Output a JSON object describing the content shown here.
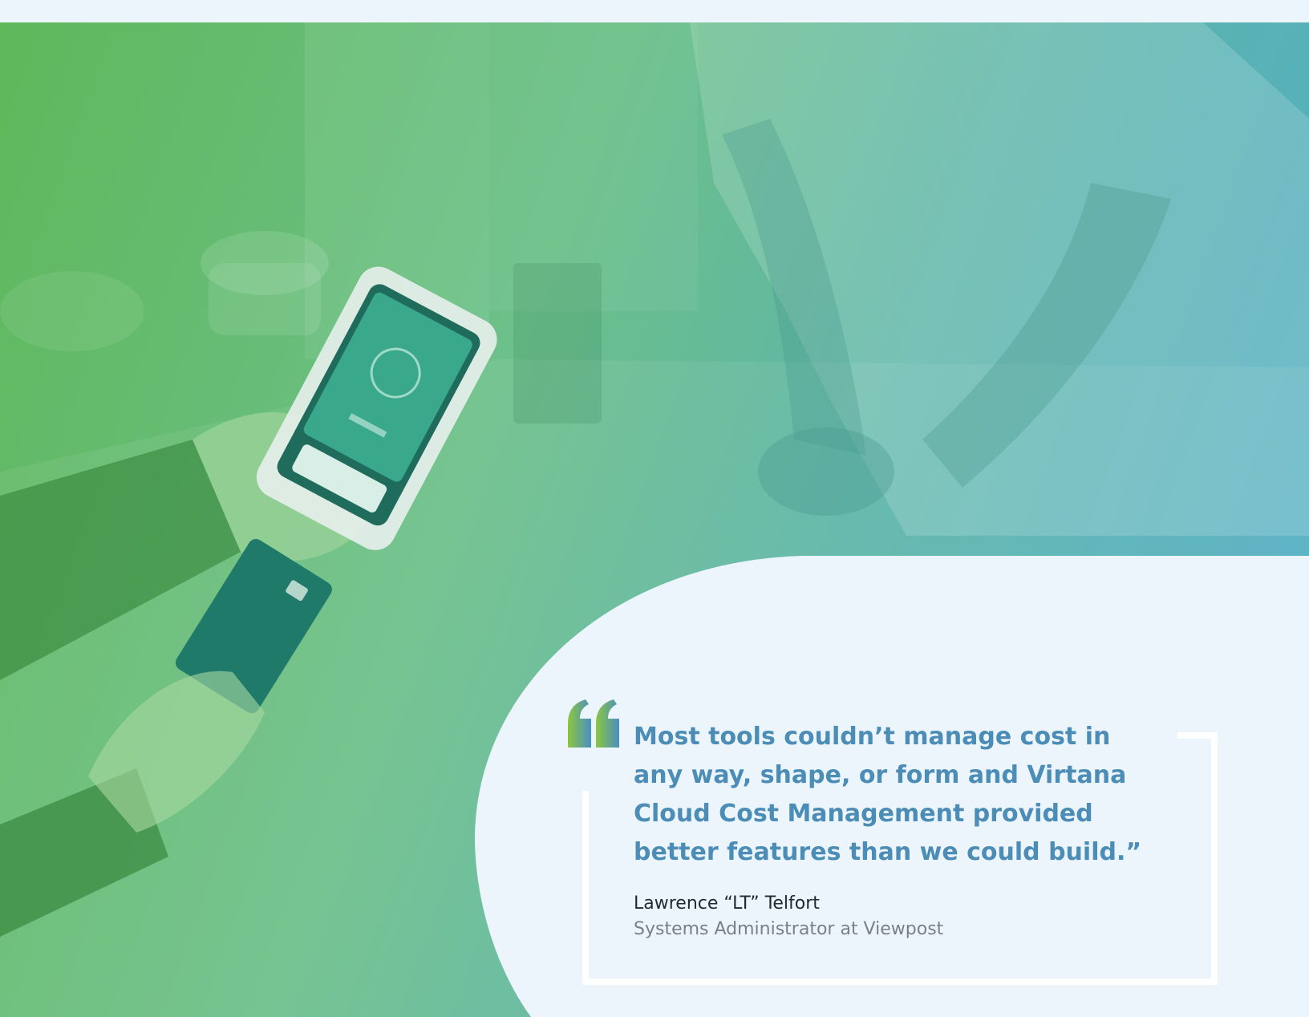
{
  "quote": {
    "text": "Most tools couldn’t manage cost in any way, shape, or form and Virtana Cloud Cost Management provided better features than we could build.”",
    "author_name": "Lawrence “LT” Telfort",
    "author_title": "Systems Administrator at Viewpost"
  },
  "photo": {
    "subject": "card-payment-at-terminal",
    "overlay_colors": [
      "#5fb85a",
      "#4faccc"
    ]
  },
  "colors": {
    "quote_text": "#4b8db7",
    "quote_mark_start": "#8cc63f",
    "quote_mark_end": "#4a8fc3",
    "background": "#edf5fc",
    "frame": "#ffffff"
  }
}
